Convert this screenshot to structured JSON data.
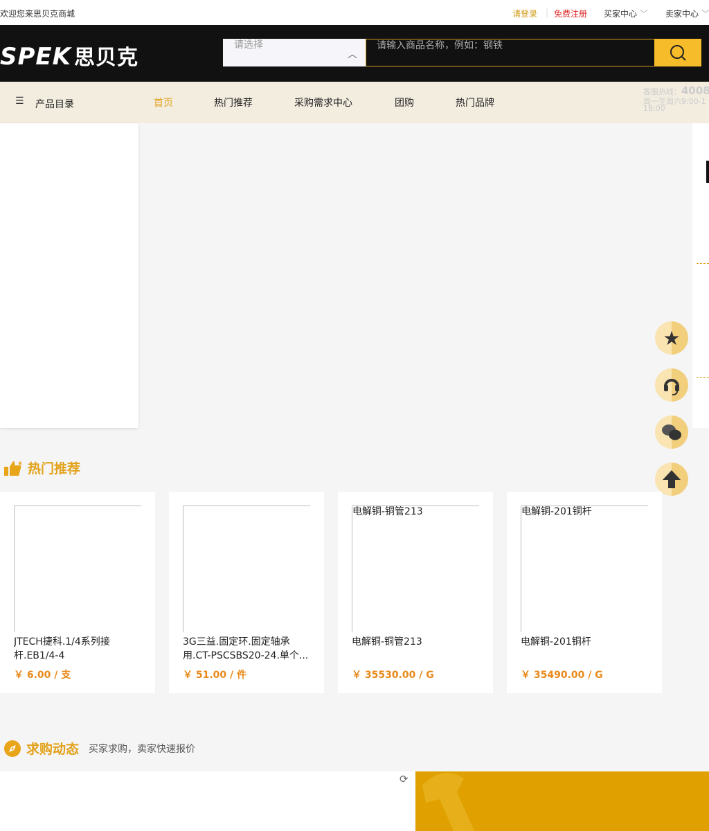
{
  "topbar": {
    "welcome": "欢迎您来思贝克商城",
    "login": "请登录",
    "register": "免费注册",
    "buyer_center": "买家中心",
    "seller_center": "卖家中心"
  },
  "header": {
    "logo_text": "SPEK",
    "logo_cn": "思贝克",
    "category_select": "请选择",
    "search_placeholder": "请输入商品名称，例如：钢铁"
  },
  "nav": {
    "catalog": "产品目录",
    "items": [
      "首页",
      "热门推荐",
      "采购需求中心",
      "团购",
      "热门品牌"
    ],
    "hotline_label": "客服热线：",
    "hotline_number": "4008",
    "hours": "周一至周六9:00-1",
    "hours2": "18:00"
  },
  "hot": {
    "title": "热门推荐",
    "products": [
      {
        "alt": "",
        "name": "JTECH捷科.1/4系列接杆.EB1/4-4",
        "price": "￥ 6.00 / 支"
      },
      {
        "alt": "",
        "name": "3G三益.固定环.固定轴承用.CT-PSCSBS20-24.单个...",
        "price": "￥ 51.00 / 件"
      },
      {
        "alt": "电解铜-铜管213",
        "name": "电解铜-铜管213",
        "price": "￥ 35530.00 / G"
      },
      {
        "alt": "电解铜-201铜杆",
        "name": "电解铜-201铜杆",
        "price": "￥ 35490.00 / G"
      }
    ]
  },
  "demand": {
    "title": "求购动态",
    "subtitle": "买家求购，卖家快速报价"
  },
  "colors": {
    "accent": "#e2a21a",
    "price": "#e8891a",
    "header": "#111111",
    "banner": "#dfa000"
  }
}
